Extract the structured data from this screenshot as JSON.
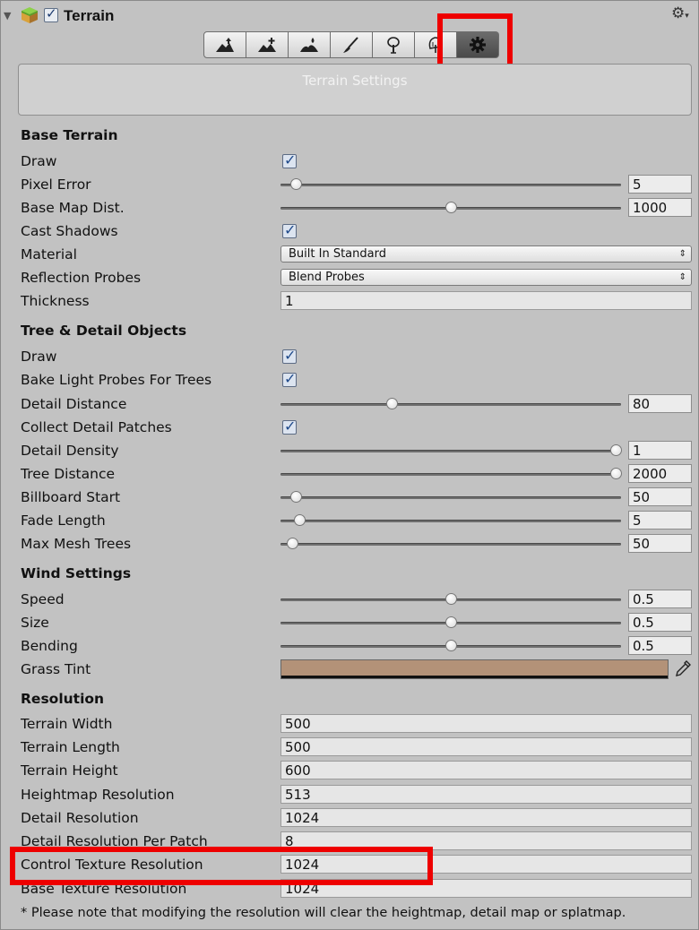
{
  "header": {
    "title": "Terrain",
    "enabled": true,
    "gear_label": "⚙",
    "gear_caret": "▾"
  },
  "toolbar": {
    "tools": [
      {
        "name": "raise-lower-terrain-icon",
        "active": false
      },
      {
        "name": "paint-height-icon",
        "active": false
      },
      {
        "name": "smooth-height-icon",
        "active": false
      },
      {
        "name": "paint-texture-icon",
        "active": false
      },
      {
        "name": "place-trees-icon",
        "active": false
      },
      {
        "name": "paint-details-icon",
        "active": false
      },
      {
        "name": "terrain-settings-gear-icon",
        "active": true
      }
    ],
    "info_label": "Terrain Settings"
  },
  "base_terrain": {
    "title": "Base Terrain",
    "draw": {
      "label": "Draw",
      "checked": true
    },
    "pixel_error": {
      "label": "Pixel Error",
      "value": "5",
      "slider_fraction": 0.03
    },
    "base_map_dist": {
      "label": "Base Map Dist.",
      "value": "1000",
      "slider_fraction": 0.5
    },
    "cast_shadows": {
      "label": "Cast Shadows",
      "checked": true
    },
    "material": {
      "label": "Material",
      "value": "Built In Standard"
    },
    "reflection_probes": {
      "label": "Reflection Probes",
      "value": "Blend Probes"
    },
    "thickness": {
      "label": "Thickness",
      "value": "1"
    }
  },
  "tree_detail": {
    "title": "Tree & Detail Objects",
    "draw": {
      "label": "Draw",
      "checked": true
    },
    "bake_light_probes": {
      "label": "Bake Light Probes For Trees",
      "checked": true
    },
    "detail_distance": {
      "label": "Detail Distance",
      "value": "80",
      "slider_fraction": 0.32
    },
    "collect_detail_patches": {
      "label": "Collect Detail Patches",
      "checked": true
    },
    "detail_density": {
      "label": "Detail Density",
      "value": "1",
      "slider_fraction": 1.0
    },
    "tree_distance": {
      "label": "Tree Distance",
      "value": "2000",
      "slider_fraction": 1.0
    },
    "billboard_start": {
      "label": "Billboard Start",
      "value": "50",
      "slider_fraction": 0.03
    },
    "fade_length": {
      "label": "Fade Length",
      "value": "5",
      "slider_fraction": 0.04
    },
    "max_mesh_trees": {
      "label": "Max Mesh Trees",
      "value": "50",
      "slider_fraction": 0.02
    }
  },
  "wind": {
    "title": "Wind Settings",
    "speed": {
      "label": "Speed",
      "value": "0.5",
      "slider_fraction": 0.5
    },
    "size": {
      "label": "Size",
      "value": "0.5",
      "slider_fraction": 0.5
    },
    "bending": {
      "label": "Bending",
      "value": "0.5",
      "slider_fraction": 0.5
    },
    "grass_tint": {
      "label": "Grass Tint",
      "color": "#b39278"
    }
  },
  "resolution": {
    "title": "Resolution",
    "terrain_width": {
      "label": "Terrain Width",
      "value": "500"
    },
    "terrain_length": {
      "label": "Terrain Length",
      "value": "500"
    },
    "terrain_height": {
      "label": "Terrain Height",
      "value": "600"
    },
    "heightmap_resolution": {
      "label": "Heightmap Resolution",
      "value": "513"
    },
    "detail_resolution": {
      "label": "Detail Resolution",
      "value": "1024"
    },
    "detail_resolution_per_patch": {
      "label": "Detail Resolution Per Patch",
      "value": "8"
    },
    "control_texture_resolution": {
      "label": "Control Texture Resolution",
      "value": "1024"
    },
    "base_texture_resolution": {
      "label": "Base Texture Resolution",
      "value": "1024"
    }
  },
  "note": "* Please note that modifying the resolution will clear the heightmap, detail map or splatmap.",
  "colors": {
    "highlight": "#ee0000",
    "panel": "#c2c2c2"
  }
}
